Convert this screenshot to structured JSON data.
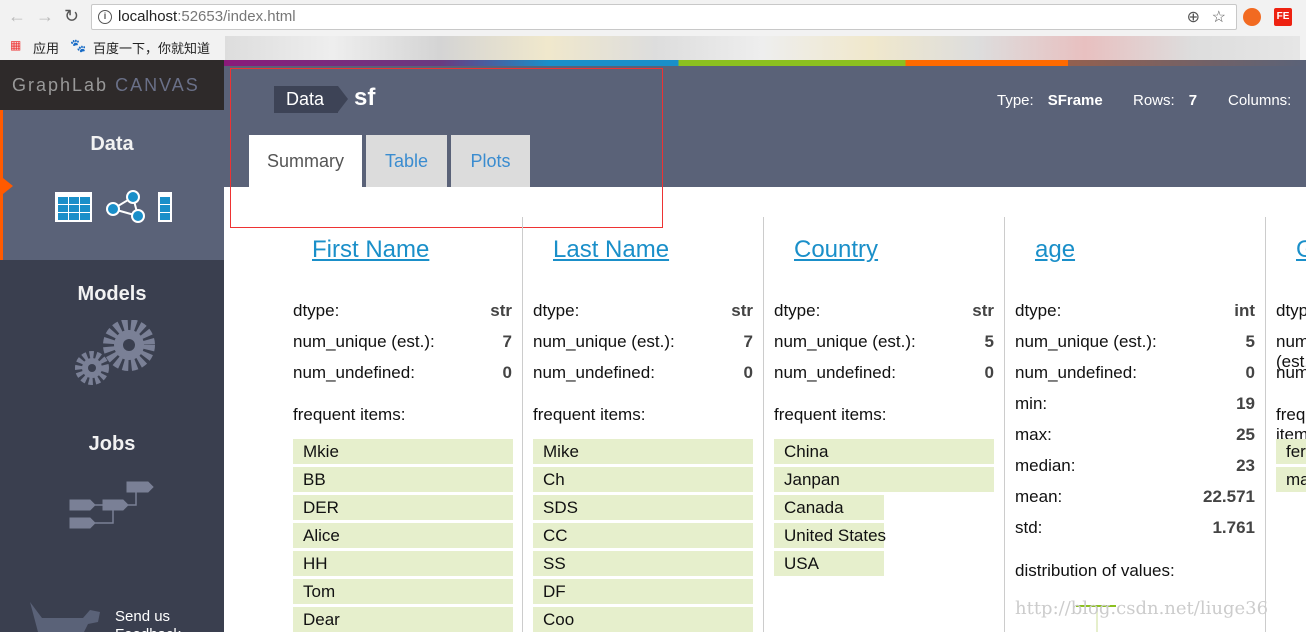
{
  "browser": {
    "url_host": "localhost",
    "url_rest": ":52653/index.html",
    "bookmarks": [
      {
        "label": "应用"
      },
      {
        "label": "百度一下，你就知道"
      }
    ]
  },
  "app": {
    "logo_a": "GraphLab",
    "logo_b": "CANVAS",
    "accent": "#ff5a00",
    "link_color": "#1a8fc9"
  },
  "sidebar": {
    "items": [
      {
        "label": "Data",
        "active": true
      },
      {
        "label": "Models"
      },
      {
        "label": "Jobs"
      }
    ],
    "feedback": "Send us Feedback"
  },
  "header": {
    "crumb": "Data",
    "name": "sf",
    "type_label": "Type:",
    "type_value": "SFrame",
    "rows_label": "Rows:",
    "rows_value": "7",
    "columns_label": "Columns:"
  },
  "tabs": [
    {
      "label": "Summary",
      "active": true
    },
    {
      "label": "Table"
    },
    {
      "label": "Plots"
    }
  ],
  "labels": {
    "dtype": "dtype:",
    "num_unique": "num_unique (est.):",
    "num_undefined": "num_undefined:",
    "frequent": "frequent items:",
    "min": "min:",
    "max": "max:",
    "median": "median:",
    "mean": "mean:",
    "std": "std:",
    "distribution": "distribution of values:"
  },
  "columns": [
    {
      "title": "First Name",
      "dtype": "str",
      "num_unique": "7",
      "num_undefined": "0",
      "frequent": [
        {
          "label": "Mkie",
          "fraction": 1
        },
        {
          "label": "BB",
          "fraction": 1
        },
        {
          "label": "DER",
          "fraction": 1
        },
        {
          "label": "Alice",
          "fraction": 1
        },
        {
          "label": "HH",
          "fraction": 1
        },
        {
          "label": "Tom",
          "fraction": 1
        },
        {
          "label": "Dear",
          "fraction": 1
        }
      ]
    },
    {
      "title": "Last Name",
      "dtype": "str",
      "num_unique": "7",
      "num_undefined": "0",
      "frequent": [
        {
          "label": "Mike",
          "fraction": 1
        },
        {
          "label": "Ch",
          "fraction": 1
        },
        {
          "label": "SDS",
          "fraction": 1
        },
        {
          "label": "CC",
          "fraction": 1
        },
        {
          "label": "SS",
          "fraction": 1
        },
        {
          "label": "DF",
          "fraction": 1
        },
        {
          "label": "Coo",
          "fraction": 1
        }
      ]
    },
    {
      "title": "Country",
      "dtype": "str",
      "num_unique": "5",
      "num_undefined": "0",
      "frequent": [
        {
          "label": "China",
          "fraction": 1
        },
        {
          "label": "Janpan",
          "fraction": 1
        },
        {
          "label": "Canada",
          "fraction": 0.5
        },
        {
          "label": "United States",
          "fraction": 0.5
        },
        {
          "label": "USA",
          "fraction": 0.5
        }
      ]
    },
    {
      "title": "age",
      "dtype": "int",
      "num_unique": "5",
      "num_undefined": "0",
      "min": "19",
      "max": "25",
      "median": "23",
      "mean": "22.571",
      "std": "1.761"
    },
    {
      "title": "G",
      "frequent": [
        {
          "label": "fer"
        },
        {
          "label": "ma"
        }
      ]
    }
  ],
  "watermark": "http://blog.csdn.net/liuge36"
}
